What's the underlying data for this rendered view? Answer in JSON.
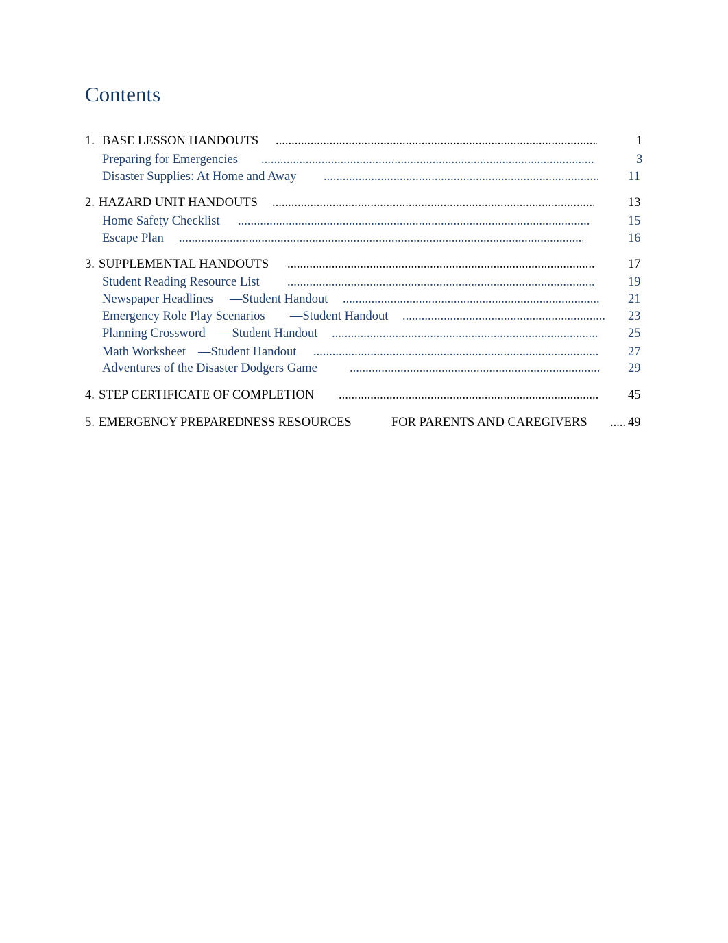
{
  "title": "Contents",
  "colors": {
    "title": "#17365d",
    "link": "#1f3e6b",
    "heading": "#000000"
  },
  "entries": [
    {
      "level": 1,
      "num": "1.",
      "text": "BASE LESSON HANDOUTS",
      "suffix": "",
      "page": "1"
    },
    {
      "level": 2,
      "num": "",
      "text": "Preparing for Emergencies",
      "suffix": "",
      "page": "3"
    },
    {
      "level": 2,
      "num": "",
      "text": "Disaster Supplies: At Home and Away",
      "suffix": "",
      "page": "11"
    },
    {
      "level": 1,
      "num": "2.",
      "text": "HAZARD UNIT HANDOUTS",
      "suffix": "",
      "page": "13"
    },
    {
      "level": 2,
      "num": "",
      "text": "Home Safety Checklist",
      "suffix": "",
      "page": "15"
    },
    {
      "level": 2,
      "num": "",
      "text": "Escape Plan",
      "suffix": "",
      "page": "16"
    },
    {
      "level": 1,
      "num": "3.",
      "text": "SUPPLEMENTAL HANDOUTS",
      "suffix": "",
      "page": "17"
    },
    {
      "level": 2,
      "num": "",
      "text": "Student Reading Resource List",
      "suffix": "",
      "page": "19"
    },
    {
      "level": 2,
      "num": "",
      "text": "Newspaper Headlines",
      "suffix": "—Student Handout",
      "page": "21"
    },
    {
      "level": 2,
      "num": "",
      "text": "Emergency Role Play Scenarios",
      "suffix": "—Student Handout",
      "page": "23"
    },
    {
      "level": 2,
      "num": "",
      "text": "Planning Crossword",
      "suffix": "—Student Handout",
      "page": "25"
    },
    {
      "level": 2,
      "num": "",
      "text": "Math Worksheet",
      "suffix": "—Student Handout",
      "page": "27"
    },
    {
      "level": 2,
      "num": "",
      "text": "Adventures of the Disaster Dodgers Game",
      "suffix": "",
      "page": "29"
    },
    {
      "level": 1,
      "num": "4.",
      "text": "STEP CERTIFICATE OF COMPLETION",
      "suffix": "",
      "page": "45"
    },
    {
      "level": 1,
      "num": "5.",
      "text": "EMERGENCY PREPAREDNESS RESOURCES",
      "suffix": "FOR PARENTS AND CAREGIVERS",
      "page": "49"
    }
  ]
}
